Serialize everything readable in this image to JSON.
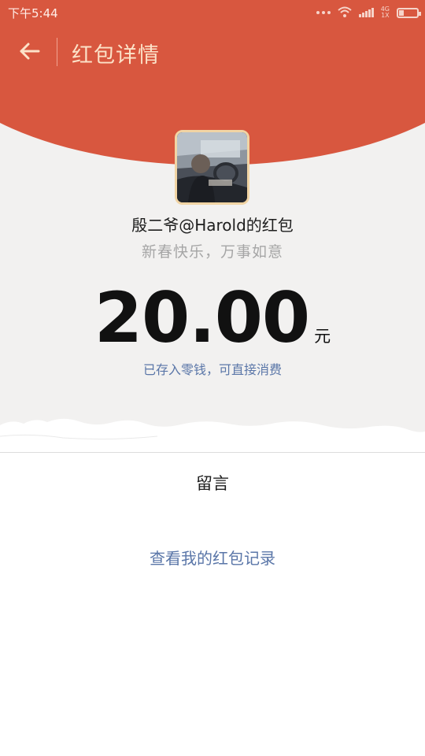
{
  "status_bar": {
    "time": "下午5:44",
    "network_type": "4G",
    "network_sub": "1X"
  },
  "nav": {
    "back_icon": "arrow-left-icon",
    "title": "红包详情"
  },
  "packet": {
    "sender": "殷二爷@Harold的红包",
    "greeting": "新春快乐，万事如意",
    "amount": "20.00",
    "unit": "元",
    "saved_note": "已存入零钱，可直接消费"
  },
  "message": {
    "label": "留言"
  },
  "footer": {
    "history_link": "查看我的红包记录"
  },
  "colors": {
    "header_red": "#d8573f",
    "title_gold": "#fce2c8",
    "link_blue": "#5a76a8",
    "background_grey": "#f2f1f0"
  }
}
